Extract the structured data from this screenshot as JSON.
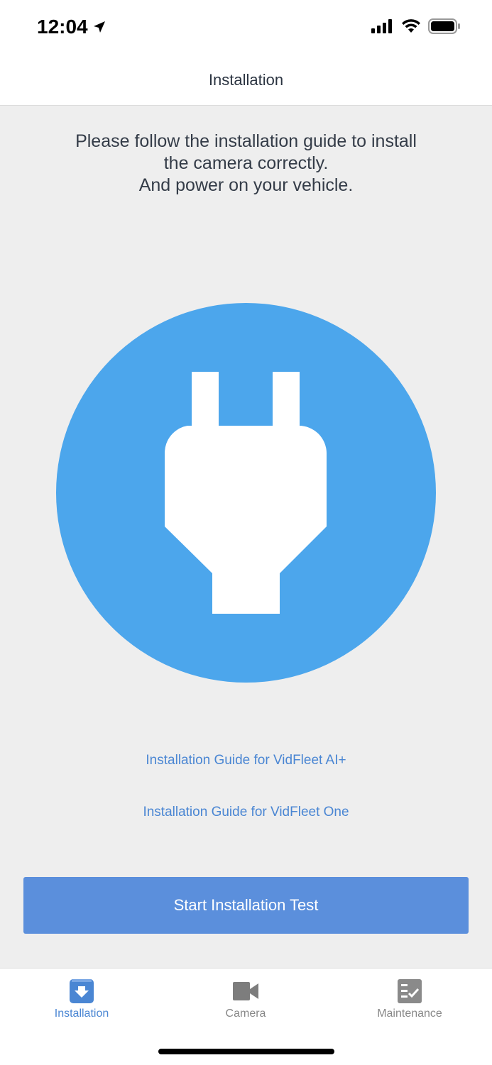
{
  "status_bar": {
    "time": "12:04",
    "icons": [
      "location-arrow-icon",
      "cellular-signal-icon",
      "wifi-icon",
      "battery-icon"
    ]
  },
  "nav": {
    "title": "Installation"
  },
  "main": {
    "instructions": [
      "Please follow the installation guide to install",
      "the camera correctly.",
      "And power on your vehicle."
    ],
    "illustration_icon": "power-plug-icon",
    "circle_color": "#4ca6ec",
    "links": [
      {
        "label": "Installation Guide for VidFleet AI+"
      },
      {
        "label": "Installation Guide for VidFleet One"
      }
    ],
    "start_button": {
      "label": "Start Installation Test",
      "color": "#5b8fdc"
    }
  },
  "tab_bar": {
    "active_color": "#4a86d3",
    "tabs": [
      {
        "label": "Installation",
        "icon": "install-download-icon",
        "active": true
      },
      {
        "label": "Camera",
        "icon": "video-camera-icon",
        "active": false
      },
      {
        "label": "Maintenance",
        "icon": "checklist-icon",
        "active": false
      }
    ]
  }
}
